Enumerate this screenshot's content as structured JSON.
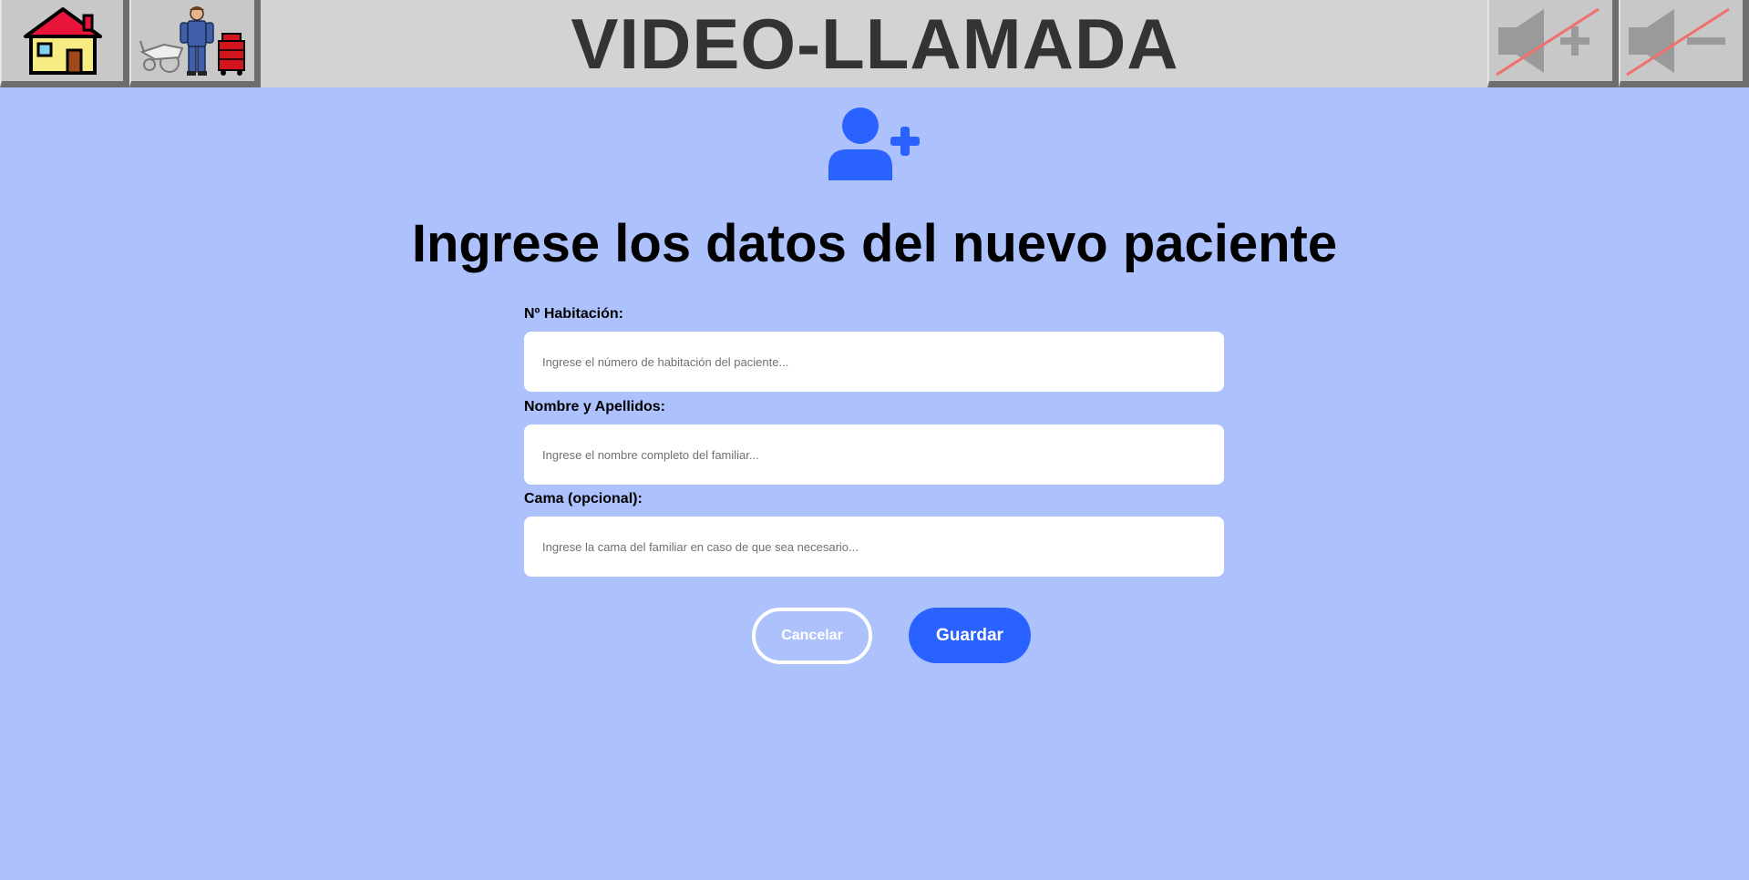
{
  "header": {
    "title": "VIDEO-LLAMADA",
    "home_icon": "house-icon",
    "staff_icon": "worker-with-equipment-icon",
    "volume_up_icon": "volume-up-disabled-icon",
    "volume_down_icon": "volume-down-disabled-icon"
  },
  "main": {
    "icon": "add-user-icon",
    "heading": "Ingrese los datos del nuevo paciente",
    "fields": [
      {
        "label": "Nº Habitación:",
        "placeholder": "Ingrese el número de habitación del paciente...",
        "value": ""
      },
      {
        "label": "Nombre y Apellidos:",
        "placeholder": "Ingrese el nombre completo del familiar...",
        "value": ""
      },
      {
        "label": "Cama (opcional):",
        "placeholder": "Ingrese la cama del familiar en caso de que sea necesario...",
        "value": ""
      }
    ],
    "cancel_label": "Cancelar",
    "save_label": "Guardar"
  },
  "colors": {
    "background": "#adc2fc",
    "topbar": "#d3d3d3",
    "accent": "#2962ff",
    "title_text": "#333333"
  }
}
